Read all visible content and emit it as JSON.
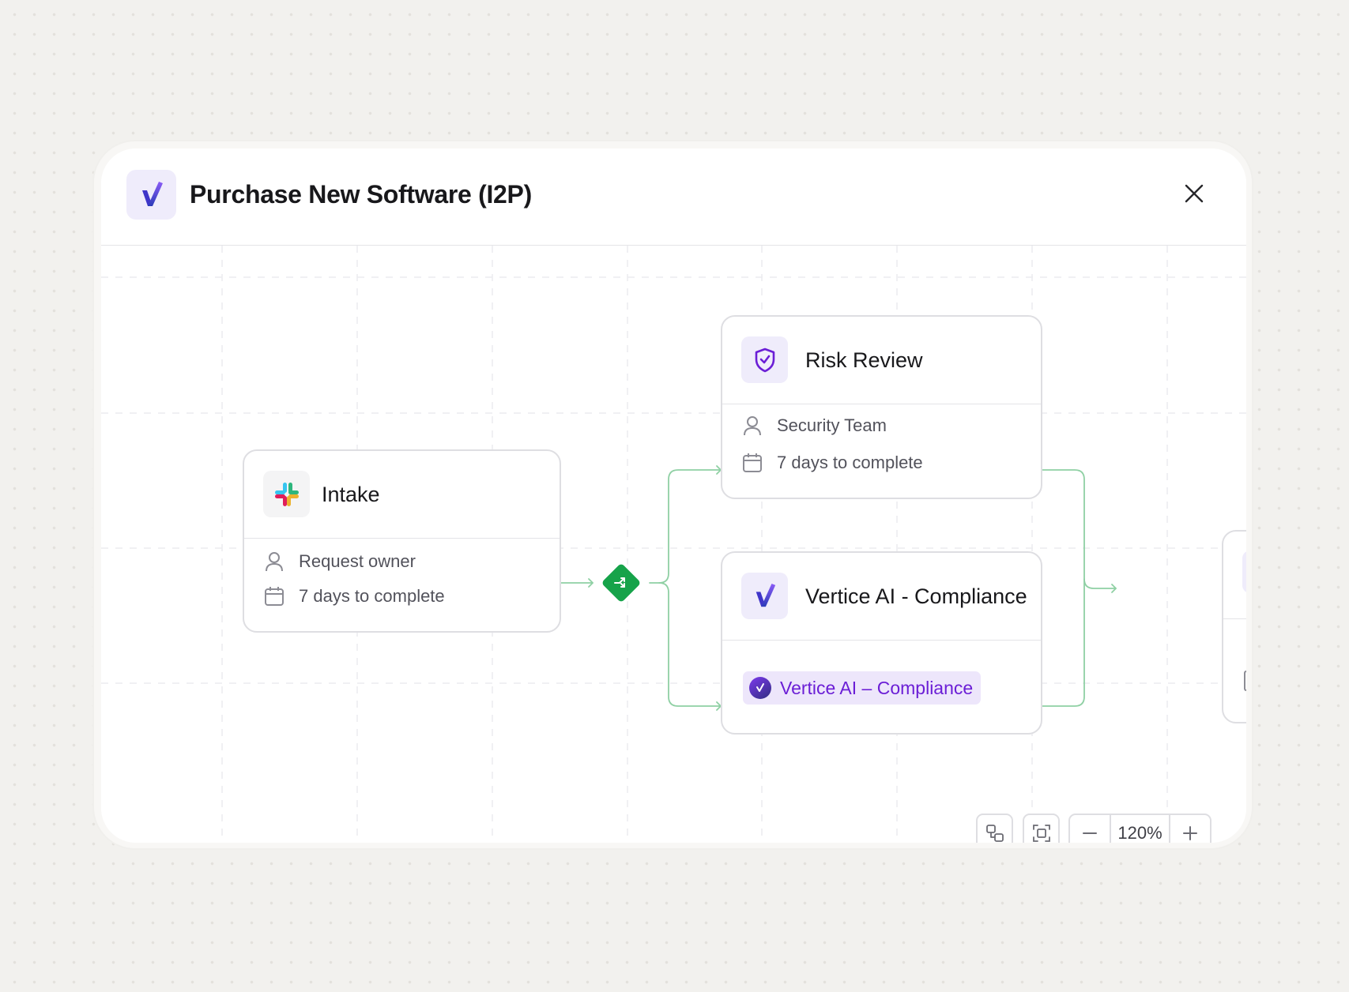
{
  "modal": {
    "title": "Purchase New Software (I2P)",
    "logo_icon": "vertice-logo-icon",
    "close_icon": "close-icon"
  },
  "workflow": {
    "intake": {
      "title": "Intake",
      "icon": "slack-icon",
      "assignee": "Request owner",
      "duration": "7 days to complete"
    },
    "gateway": {
      "icon": "branch-icon",
      "color": "#16a34a"
    },
    "risk_review": {
      "title": "Risk Review",
      "icon": "shield-check-icon",
      "assignee": "Security Team",
      "duration": "7 days to complete"
    },
    "ai_compliance": {
      "title": "Vertice AI - Compliance",
      "icon": "vertice-logo-icon",
      "badge": "Vertice AI – Compliance"
    },
    "edge_color": "#8fd0a4"
  },
  "toolbar": {
    "layout_icon": "auto-layout-icon",
    "fit_icon": "fit-view-icon",
    "zoom_out_icon": "minus-icon",
    "zoom_level": "120%",
    "zoom_in_icon": "plus-icon"
  },
  "colors": {
    "accent_purple": "#6b1ed6",
    "accent_purple_bg": "#ede6fb",
    "gateway_green": "#16a34a"
  }
}
